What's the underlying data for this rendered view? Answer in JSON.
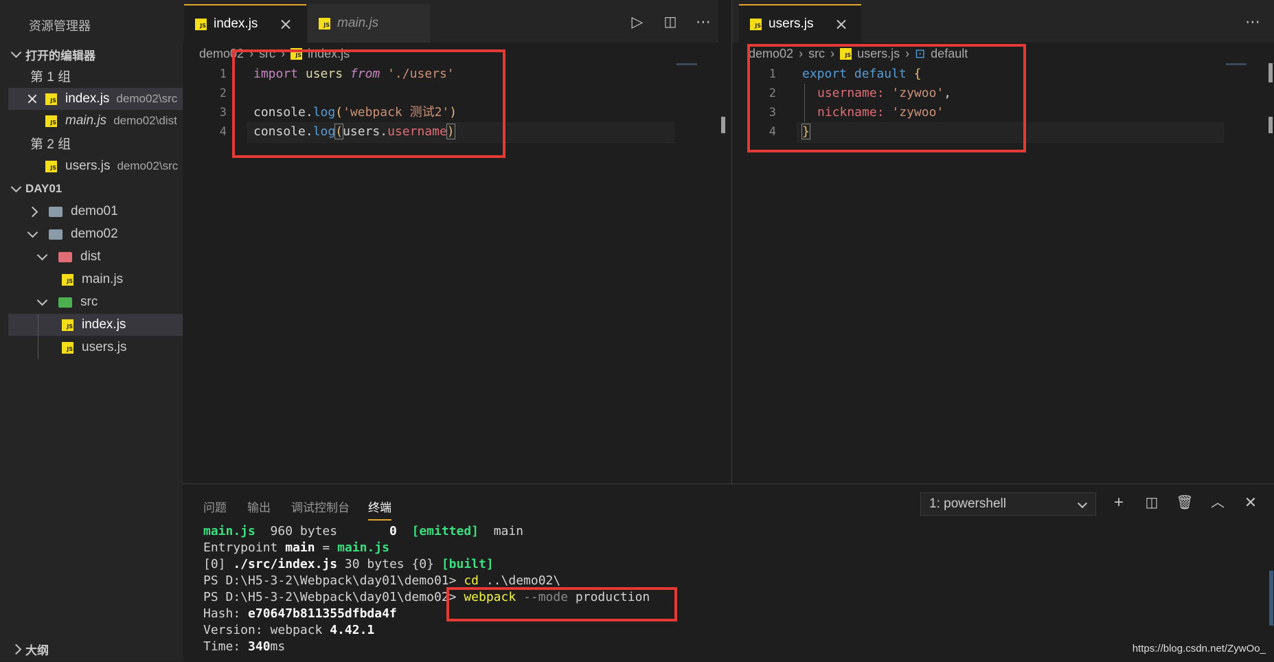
{
  "explorer": {
    "title": "资源管理器",
    "open_editors": "打开的编辑器",
    "group1": "第 1 组",
    "group2": "第 2 组",
    "open_files": [
      {
        "name": "index.js",
        "path": "demo02\\src"
      },
      {
        "name": "main.js",
        "path": "demo02\\dist"
      },
      {
        "name": "users.js",
        "path": "demo02\\src"
      }
    ],
    "workspace": "DAY01",
    "tree": {
      "demo01": "demo01",
      "demo02": "demo02",
      "dist": "dist",
      "main": "main.js",
      "src": "src",
      "index": "index.js",
      "users": "users.js"
    },
    "outline": "大纲"
  },
  "editor1": {
    "tabs": [
      {
        "label": "index.js"
      },
      {
        "label": "main.js"
      }
    ],
    "breadcrumb": [
      "demo02",
      "src",
      "index.js"
    ],
    "line_numbers": [
      "1",
      "2",
      "3",
      "4"
    ],
    "code": {
      "l1_import": "import",
      "l1_users": "users",
      "l1_from": "from",
      "l1_path": "'./users'",
      "l3_console": "console",
      "l3_log": "log",
      "l3_str": "'webpack 测试2'",
      "l4_console": "console",
      "l4_log": "log",
      "l4_users": "users",
      "l4_prop": "username"
    }
  },
  "editor2": {
    "tabs": [
      {
        "label": "users.js"
      }
    ],
    "breadcrumb": [
      "demo02",
      "src",
      "users.js",
      "default"
    ],
    "line_numbers": [
      "1",
      "2",
      "3",
      "4"
    ],
    "code": {
      "l1_export": "export",
      "l1_default": "default",
      "l2_key": "username:",
      "l2_val": "'zywoo'",
      "l3_key": "nickname:",
      "l3_val": "'zywoo'"
    }
  },
  "panel": {
    "tabs": [
      "问题",
      "输出",
      "调试控制台",
      "终端"
    ],
    "terminal_select": "1: powershell",
    "lines": {
      "t1_file": "main.js",
      "t1_size": "960 bytes",
      "t1_chunk": "0",
      "t1_emitted": "[emitted]",
      "t1_name": "main",
      "t2_label": "Entrypoint",
      "t2_main": "main",
      "t2_eq": "=",
      "t2_file": "main.js",
      "t3_id": "[0]",
      "t3_path": "./src/index.js",
      "t3_size": "30 bytes",
      "t3_chunk": "{0}",
      "t3_built": "[built]",
      "t4_prompt": "PS D:\\H5-3-2\\Webpack\\day01\\demo01>",
      "t4_cmd": "cd",
      "t4_arg": "..\\demo02\\",
      "t5_prompt": "PS D:\\H5-3-2\\Webpack\\day01\\demo02>",
      "t5_cmd": "webpack",
      "t5_flag": "--mode",
      "t5_arg": "production",
      "t6_label": "Hash:",
      "t6_val": "e70647b811355dfbda4f",
      "t7_label": "Version: webpack",
      "t7_val": "4.42.1",
      "t8_label": "Time:",
      "t8_val": "340",
      "t8_unit": "ms"
    }
  },
  "watermark": "https://blog.csdn.net/ZywOo_",
  "colors": {
    "highlight_box": "#e53935",
    "tab_accent": "#e4a72b"
  }
}
